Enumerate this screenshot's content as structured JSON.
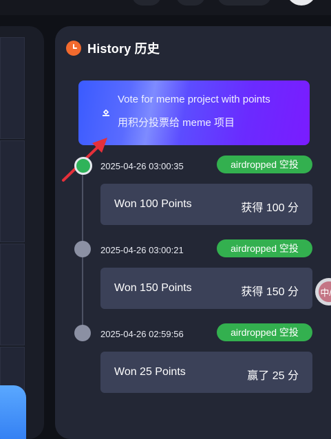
{
  "history": {
    "title": "History 历史",
    "banner": {
      "line1": "Vote for meme project with points",
      "line2": "用积分投票给 meme 项目"
    },
    "entries": [
      {
        "time": "2025-04-26 03:00:35",
        "badge": "airdropped 空投",
        "won": "Won 100 Points",
        "detail": "获得 100 分",
        "active": true
      },
      {
        "time": "2025-04-26 03:00:21",
        "badge": "airdropped 空投",
        "won": "Won 150 Points",
        "detail": "获得 150 分",
        "active": false
      },
      {
        "time": "2025-04-26 02:59:56",
        "badge": "airdropped 空投",
        "won": "Won 25 Points",
        "detail": "赢了 25 分",
        "active": false
      }
    ]
  },
  "float_bubble": {
    "label": "中/A"
  },
  "colors": {
    "panel": "#232735",
    "card": "#3b4158",
    "badge": "#33b04f",
    "accent_orange": "#f26a2e",
    "arrow_red": "#e5303a",
    "banner_start": "#3a5bff",
    "banner_end": "#7a1cff"
  },
  "icons": {
    "history": "clock-icon",
    "banner": "vote-icon",
    "pointer": "red-arrow-icon"
  }
}
